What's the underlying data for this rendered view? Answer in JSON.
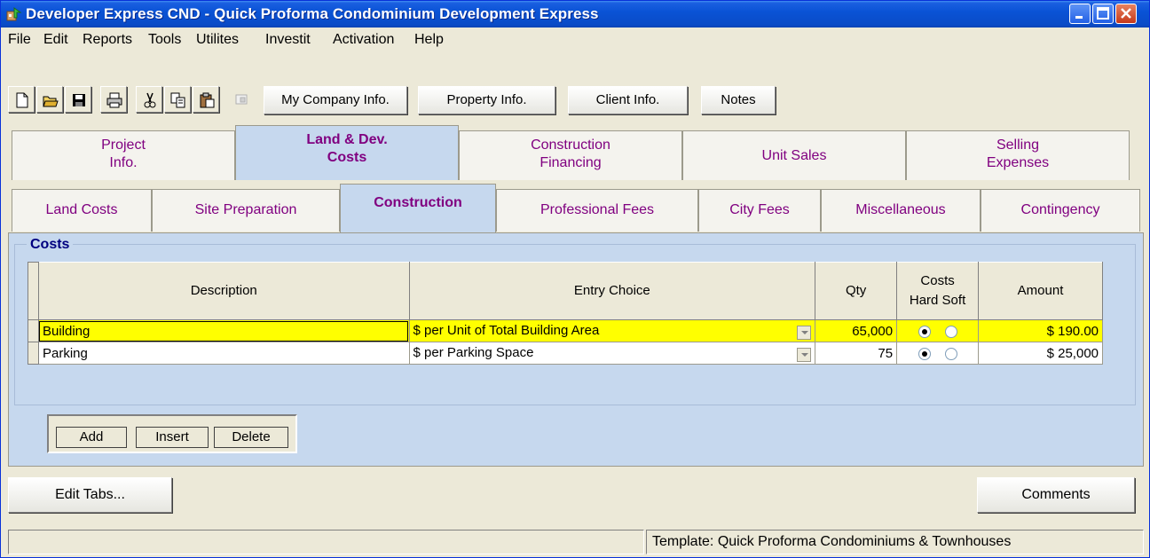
{
  "window": {
    "title": "Developer Express  CND - Quick Proforma Condominium Development  Express"
  },
  "menu": [
    {
      "label": "File"
    },
    {
      "label": "Edit"
    },
    {
      "label": "Reports"
    },
    {
      "label": "Tools"
    },
    {
      "label": "Utilites"
    },
    {
      "label": "Investit"
    },
    {
      "label": "Activation"
    },
    {
      "label": "Help"
    }
  ],
  "toolbar": {
    "icons": [
      "new-file-icon",
      "open-folder-icon",
      "save-icon",
      "print-icon",
      "cut-icon",
      "copy-icon",
      "paste-icon",
      "disabled-icon"
    ],
    "buttons": [
      {
        "label": "My Company Info."
      },
      {
        "label": "Property Info."
      },
      {
        "label": "Client Info."
      },
      {
        "label": "Notes"
      }
    ]
  },
  "main_tabs": [
    {
      "line1": "Project",
      "line2": "Info."
    },
    {
      "line1": "Land & Dev.",
      "line2": "Costs"
    },
    {
      "line1": "Construction",
      "line2": "Financing"
    },
    {
      "line1": "Unit Sales",
      "line2": ""
    },
    {
      "line1": "Selling",
      "line2": "Expenses"
    }
  ],
  "sub_tabs": [
    {
      "label": "Land Costs"
    },
    {
      "label": "Site Preparation"
    },
    {
      "label": "Construction"
    },
    {
      "label": "Professional Fees"
    },
    {
      "label": "City Fees"
    },
    {
      "label": "Miscellaneous"
    },
    {
      "label": "Contingency"
    }
  ],
  "costs": {
    "group_title": "Costs",
    "columns": {
      "description": "Description",
      "entry_choice": "Entry Choice",
      "qty": "Qty",
      "costs_line1": "Costs",
      "costs_line2": "Hard Soft",
      "amount": "Amount"
    },
    "rows": [
      {
        "description": "Building",
        "entry_choice": "$ per Unit of Total Building Area",
        "qty": "65,000",
        "hard": true,
        "amount": "$ 190.00"
      },
      {
        "description": "Parking",
        "entry_choice": "$ per Parking Space",
        "qty": "75",
        "hard": true,
        "amount": "$ 25,000"
      }
    ],
    "buttons": {
      "add": "Add",
      "insert": "Insert",
      "delete": "Delete"
    }
  },
  "footer": {
    "edit_tabs": "Edit Tabs...",
    "comments": "Comments",
    "status_left": "",
    "status_right": "Template: Quick Proforma Condominiums & Townhouses"
  }
}
